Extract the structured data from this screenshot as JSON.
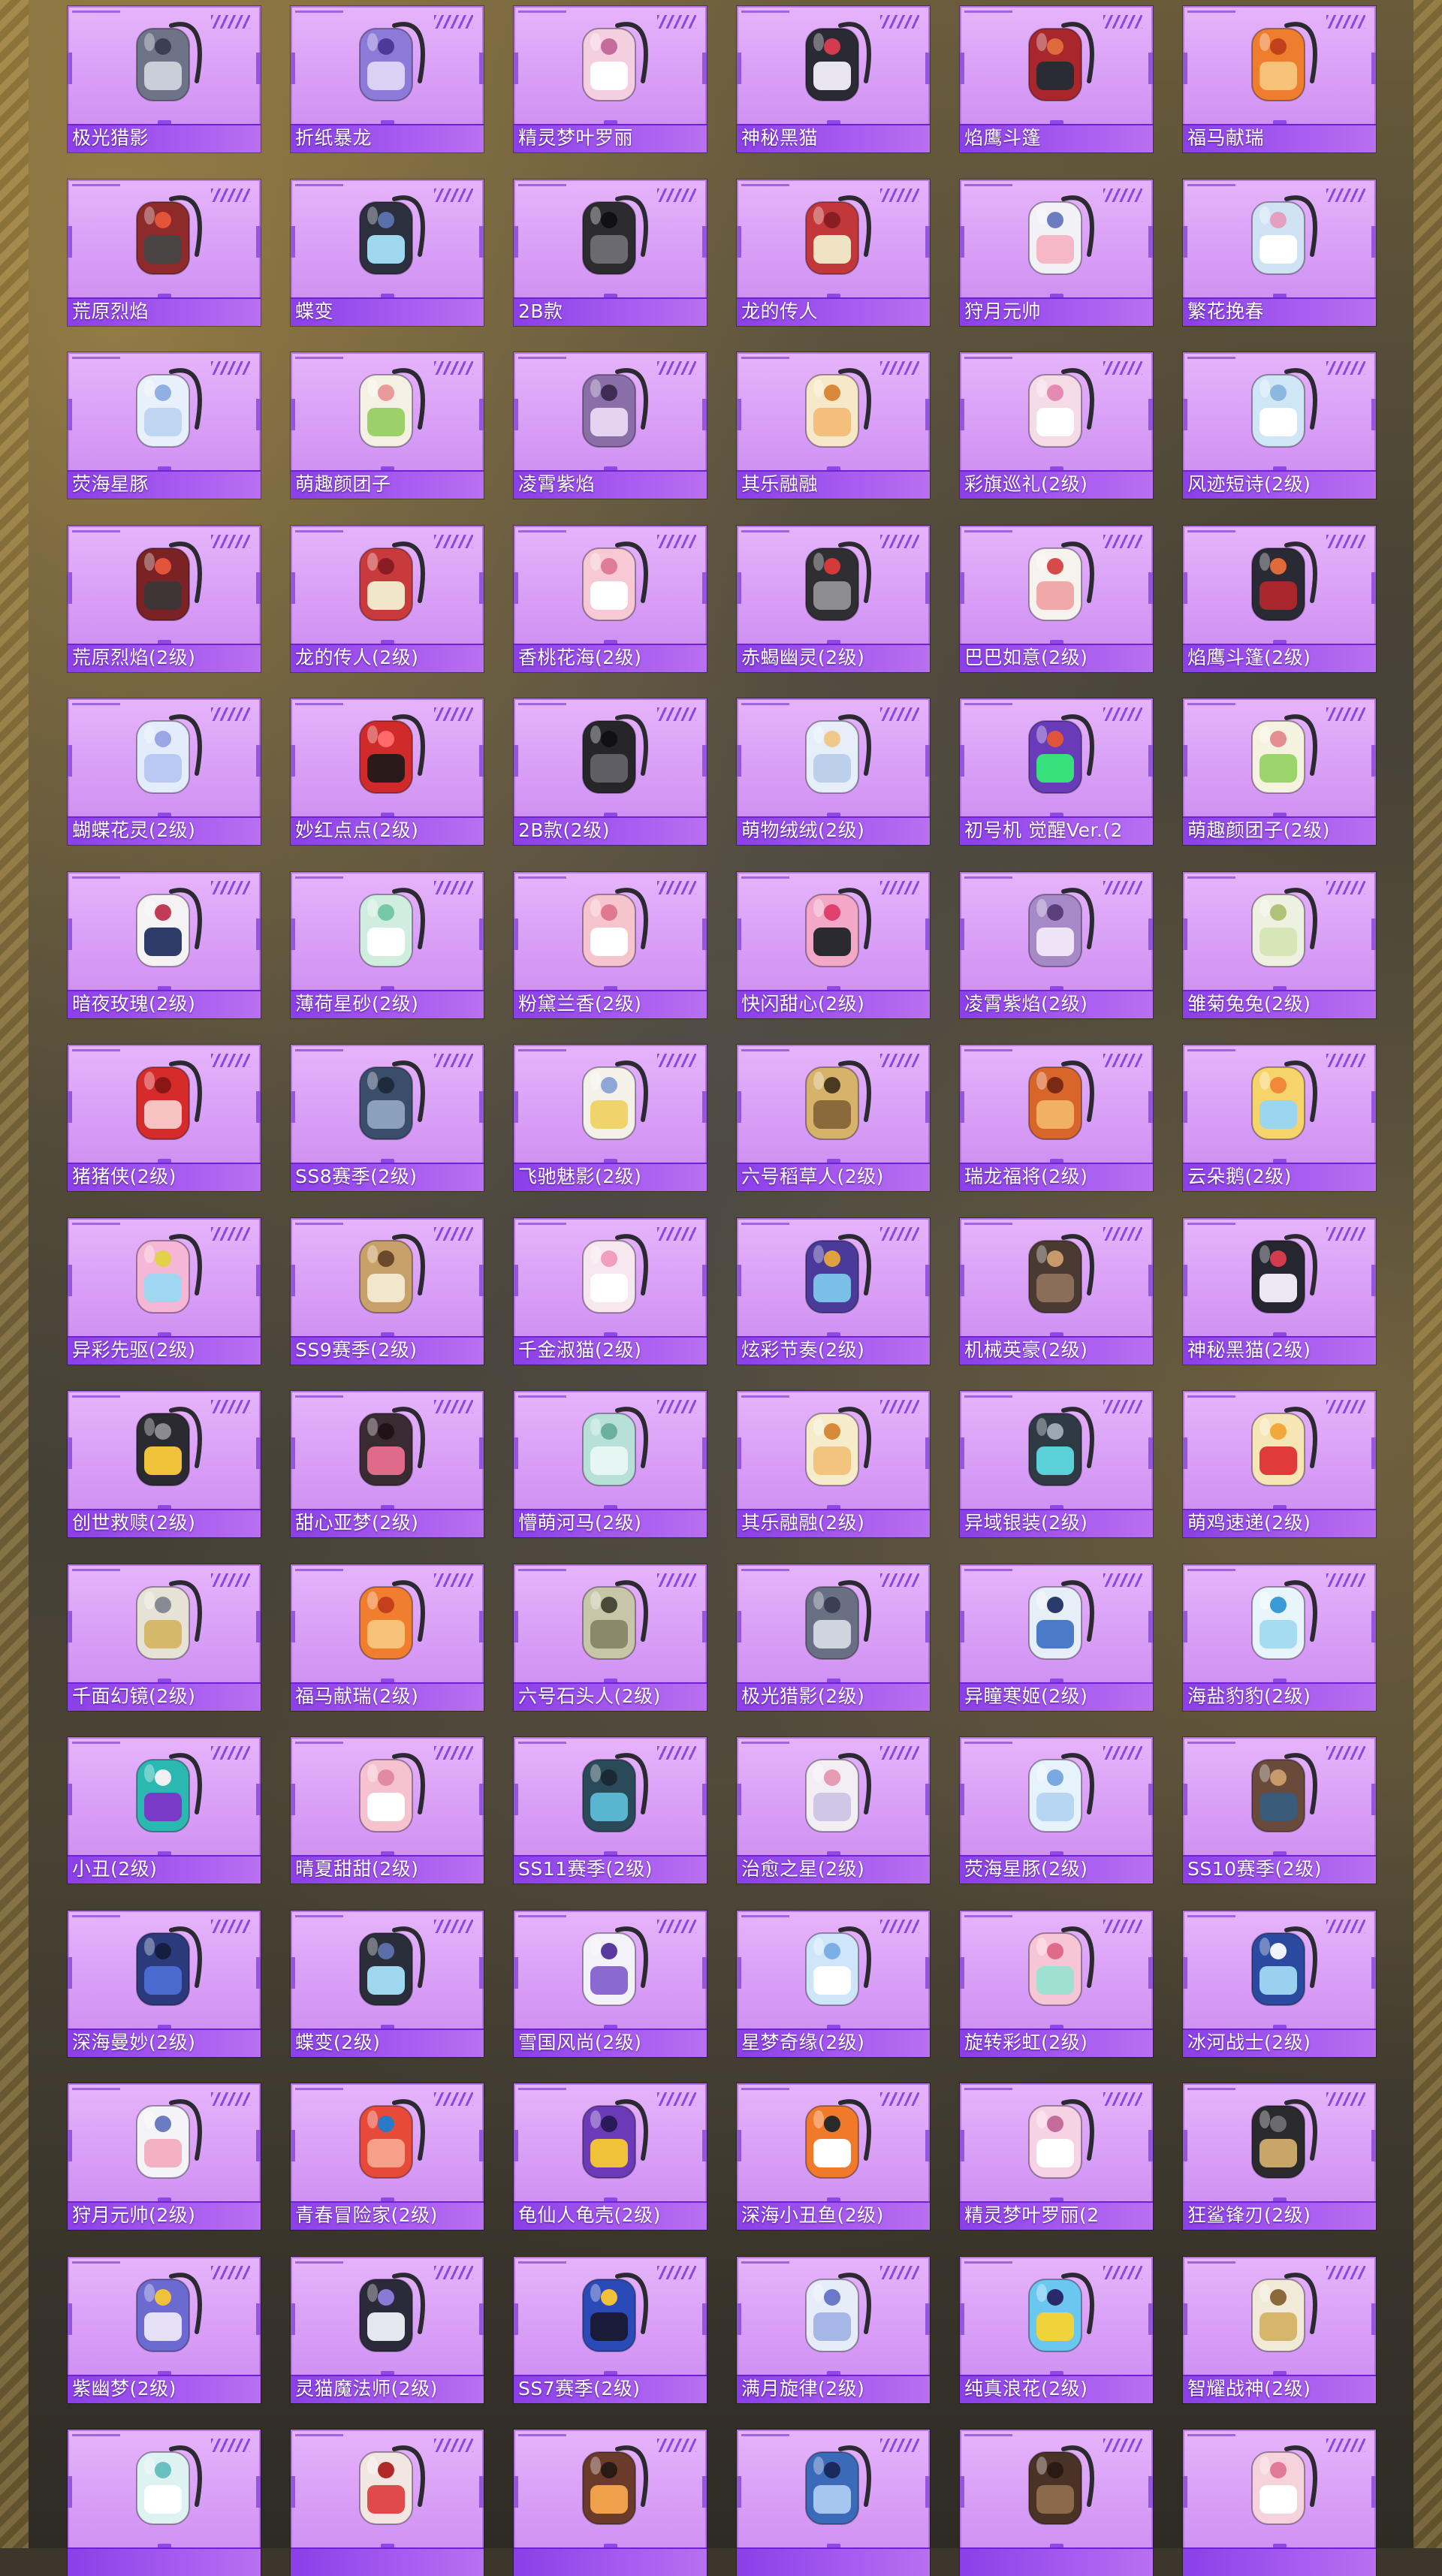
{
  "colors": {
    "card_bg": "#dca3f7",
    "label_bar": "#9a4ded",
    "label_text": "#ffffff",
    "stripe_accent": "#8b48e0"
  },
  "backpacks": [
    {
      "name": "极光猎影",
      "icon": "robot-claw-backpack-icon",
      "primary": "#6e7488",
      "secondary": "#c9ced8",
      "accent": "#3b3f55"
    },
    {
      "name": "折纸暴龙",
      "icon": "origami-dino-backpack-icon",
      "primary": "#8b7ad8",
      "secondary": "#d9d2f5",
      "accent": "#4b3a99"
    },
    {
      "name": "精灵梦叶罗丽",
      "icon": "heart-locket-backpack-icon",
      "primary": "#f3cfe0",
      "secondary": "#ffffff",
      "accent": "#c46c9c"
    },
    {
      "name": "神秘黑猫",
      "icon": "black-cat-backpack-icon",
      "primary": "#2a2a35",
      "secondary": "#e9e5ef",
      "accent": "#d33b4f"
    },
    {
      "name": "焰鹰斗篷",
      "icon": "red-armor-backpack-icon",
      "primary": "#a8262c",
      "secondary": "#2b2b33",
      "accent": "#e06b3a"
    },
    {
      "name": "福马献瑞",
      "icon": "orange-horse-backpack-icon",
      "primary": "#ef7d2e",
      "secondary": "#f6c27a",
      "accent": "#c2411c"
    },
    {
      "name": "荒原烈焰",
      "icon": "red-tactical-backpack-icon",
      "primary": "#8e2a2a",
      "secondary": "#4a4444",
      "accent": "#e3543b"
    },
    {
      "name": "蝶变",
      "icon": "butterfly-backpack-icon",
      "primary": "#2b2f3e",
      "secondary": "#9fd7ef",
      "accent": "#5a6fa8"
    },
    {
      "name": "2B款",
      "icon": "black-leather-backpack-icon",
      "primary": "#2c2c2f",
      "secondary": "#6a6a70",
      "accent": "#111114"
    },
    {
      "name": "龙的传人",
      "icon": "dragon-red-backpack-icon",
      "primary": "#c2383a",
      "secondary": "#f0e3c4",
      "accent": "#8a1d23"
    },
    {
      "name": "狩月元帅",
      "icon": "moon-marshal-backpack-icon",
      "primary": "#f2f2f6",
      "secondary": "#f6b7c6",
      "accent": "#6b7dc0"
    },
    {
      "name": "繁花挽春",
      "icon": "flower-bag-backpack-icon",
      "primary": "#cfe3f5",
      "secondary": "#ffffff",
      "accent": "#e59fbf"
    },
    {
      "name": "荧海星豚",
      "icon": "star-dolphin-backpack-icon",
      "primary": "#e8f0fb",
      "secondary": "#bfd6f2",
      "accent": "#8fb0e0"
    },
    {
      "name": "萌趣颜团子",
      "icon": "green-bunny-plush-icon",
      "primary": "#f4f1e4",
      "secondary": "#9cd16a",
      "accent": "#e99a9a"
    },
    {
      "name": "凌霄紫焰",
      "icon": "purple-flame-ornament-icon",
      "primary": "#8a6ea8",
      "secondary": "#e4d4f2",
      "accent": "#3d2d52"
    },
    {
      "name": "其乐融融",
      "icon": "cupcake-bunny-backpack-icon",
      "primary": "#f6e8c8",
      "secondary": "#f2c07a",
      "accent": "#d88a3a"
    },
    {
      "name": "彩旗巡礼(2级)",
      "icon": "bunny-ribbon-backpack-icon",
      "primary": "#f4dbe6",
      "secondary": "#ffffff",
      "accent": "#e48bb4"
    },
    {
      "name": "风迹短诗(2级)",
      "icon": "blue-box-backpack-icon",
      "primary": "#cfe6f6",
      "secondary": "#ffffff",
      "accent": "#8bb7e0"
    },
    {
      "name": "荒原烈焰(2级)",
      "icon": "red-tactical-backpack-icon",
      "primary": "#7a2224",
      "secondary": "#3d3536",
      "accent": "#e3543b"
    },
    {
      "name": "龙的传人(2级)",
      "icon": "dragon-red-backpack-icon",
      "primary": "#c83a3c",
      "secondary": "#f2e6c8",
      "accent": "#8a1d23"
    },
    {
      "name": "香桃花海(2级)",
      "icon": "peach-blossom-backpack-icon",
      "primary": "#f6c9d4",
      "secondary": "#ffffff",
      "accent": "#e07c98"
    },
    {
      "name": "赤蝎幽灵(2级)",
      "icon": "scorpion-ghost-backpack-icon",
      "primary": "#2e2e33",
      "secondary": "#8d8d92",
      "accent": "#d33b3b"
    },
    {
      "name": "巴巴如意(2级)",
      "icon": "white-bunny-backpack-icon",
      "primary": "#f6f3ee",
      "secondary": "#f0a8a8",
      "accent": "#d64a4a"
    },
    {
      "name": "焰鹰斗篷(2级)",
      "icon": "red-armor-backpack-icon",
      "primary": "#2a2a34",
      "secondary": "#a8262c",
      "accent": "#e06b3a"
    },
    {
      "name": "蝴蝶花灵(2级)",
      "icon": "butterfly-fairy-backpack-icon",
      "primary": "#e2ecfb",
      "secondary": "#b9c9f3",
      "accent": "#9aa6e6"
    },
    {
      "name": "妙红点点(2级)",
      "icon": "ladybug-backpack-icon",
      "primary": "#d12a2a",
      "secondary": "#2a1a1a",
      "accent": "#ff6b6b"
    },
    {
      "name": "2B款(2级)",
      "icon": "black-leather-backpack-icon",
      "primary": "#262629",
      "secondary": "#5e5e64",
      "accent": "#111114"
    },
    {
      "name": "萌物绒绒(2级)",
      "icon": "fluffy-bunny-backpack-icon",
      "primary": "#e5eef9",
      "secondary": "#bcd0ec",
      "accent": "#f0c98a"
    },
    {
      "name": "初号机 觉醒Ver.(2",
      "icon": "eva-unit-backpack-icon",
      "primary": "#6a3bb8",
      "secondary": "#36e07a",
      "accent": "#e0553a"
    },
    {
      "name": "萌趣颜团子(2级)",
      "icon": "green-bunny-plush-icon",
      "primary": "#f6f2e0",
      "secondary": "#9bd46a",
      "accent": "#e48f8f"
    },
    {
      "name": "暗夜玫瑰(2级)",
      "icon": "rose-bunny-backpack-icon",
      "primary": "#f4f2f2",
      "secondary": "#2f3c6a",
      "accent": "#c23c5a"
    },
    {
      "name": "薄荷星砂(2级)",
      "icon": "mint-star-backpack-icon",
      "primary": "#cfeee0",
      "secondary": "#ffffff",
      "accent": "#76c7a6"
    },
    {
      "name": "粉黛兰香(2级)",
      "icon": "pink-orchid-pouch-icon",
      "primary": "#f6c4cc",
      "secondary": "#ffffff",
      "accent": "#e07890"
    },
    {
      "name": "快闪甜心(2级)",
      "icon": "pink-round-bag-icon",
      "primary": "#f2a8c6",
      "secondary": "#2a2a30",
      "accent": "#e0406e"
    },
    {
      "name": "凌霄紫焰(2级)",
      "icon": "purple-flame-ornament-icon",
      "primary": "#a68ac8",
      "secondary": "#efe3f8",
      "accent": "#5a3f7a"
    },
    {
      "name": "雏菊兔兔(2级)",
      "icon": "daisy-bunny-backpack-icon",
      "primary": "#eef0e0",
      "secondary": "#d6e6b6",
      "accent": "#b0c27a"
    },
    {
      "name": "猪猪侠(2级)",
      "icon": "red-pig-backpack-icon",
      "primary": "#d62b2b",
      "secondary": "#f7c2c2",
      "accent": "#8a1616"
    },
    {
      "name": "SS8赛季(2级)",
      "icon": "blue-hiking-backpack-icon",
      "primary": "#3a4d6a",
      "secondary": "#8aa0bc",
      "accent": "#1f2a3d"
    },
    {
      "name": "飞驰魅影(2级)",
      "icon": "white-racer-backpack-icon",
      "primary": "#f4f1e8",
      "secondary": "#f0d36a",
      "accent": "#8fa7d6"
    },
    {
      "name": "六号稻草人(2级)",
      "icon": "scarecrow-backpack-icon",
      "primary": "#d6b26a",
      "secondary": "#8a6a3a",
      "accent": "#4a3a22"
    },
    {
      "name": "瑞龙福将(2级)",
      "icon": "orange-armor-backpack-icon",
      "primary": "#d8662a",
      "secondary": "#f2b064",
      "accent": "#7a2a14"
    },
    {
      "name": "云朵鹅(2级)",
      "icon": "yellow-duck-backpack-icon",
      "primary": "#f6d46a",
      "secondary": "#9bd6ee",
      "accent": "#f08a3a"
    },
    {
      "name": "异彩先驱(2级)",
      "icon": "colorful-pioneer-backpack-icon",
      "primary": "#f6b6d6",
      "secondary": "#9fd6f0",
      "accent": "#e2d24a"
    },
    {
      "name": "SS9赛季(2级)",
      "icon": "tan-canvas-backpack-icon",
      "primary": "#c8a06a",
      "secondary": "#f2e6cc",
      "accent": "#6a4a2a"
    },
    {
      "name": "千金淑猫(2级)",
      "icon": "lady-cat-backpack-icon",
      "primary": "#f6e8ee",
      "secondary": "#ffffff",
      "accent": "#f0a0be"
    },
    {
      "name": "炫彩节奏(2级)",
      "icon": "galaxy-rhythm-backpack-icon",
      "primary": "#4a3a9a",
      "secondary": "#7ac0e6",
      "accent": "#e0a040"
    },
    {
      "name": "机械英豪(2级)",
      "icon": "mech-hero-backpack-icon",
      "primary": "#4a3a32",
      "secondary": "#8a6e5a",
      "accent": "#c89a6a"
    },
    {
      "name": "神秘黑猫(2级)",
      "icon": "black-cat-backpack-icon",
      "primary": "#262630",
      "secondary": "#ece8f2",
      "accent": "#d33b4f"
    },
    {
      "name": "创世救赎(2级)",
      "icon": "genesis-armor-backpack-icon",
      "primary": "#2a2a30",
      "secondary": "#f0c23a",
      "accent": "#8a8a92"
    },
    {
      "name": "甜心亚梦(2级)",
      "icon": "dark-sweetheart-backpack-icon",
      "primary": "#3a2a32",
      "secondary": "#e06a8a",
      "accent": "#1e1418"
    },
    {
      "name": "懵萌河马(2级)",
      "icon": "hippo-plush-backpack-icon",
      "primary": "#b6e0d8",
      "secondary": "#e6f6f2",
      "accent": "#6ab0a0"
    },
    {
      "name": "其乐融融(2级)",
      "icon": "cupcake-bunny-backpack-icon",
      "primary": "#f6eccc",
      "secondary": "#f2c47e",
      "accent": "#d88a3a"
    },
    {
      "name": "异域银装(2级)",
      "icon": "silver-tech-backpack-icon",
      "primary": "#2f3a44",
      "secondary": "#5ad0d8",
      "accent": "#9aa8b4"
    },
    {
      "name": "萌鸡速递(2级)",
      "icon": "chick-courier-backpack-icon",
      "primary": "#f6e6b6",
      "secondary": "#e03a3a",
      "accent": "#f2a83a"
    },
    {
      "name": "千面幻镜(2级)",
      "icon": "mirror-gold-backpack-icon",
      "primary": "#e6e2d6",
      "secondary": "#d6b86a",
      "accent": "#8a8a96"
    },
    {
      "name": "福马献瑞(2级)",
      "icon": "orange-horse-backpack-icon",
      "primary": "#f07e2e",
      "secondary": "#f6c27a",
      "accent": "#c2411c"
    },
    {
      "name": "六号石头人(2级)",
      "icon": "stone-golem-backpack-icon",
      "primary": "#c8c6a8",
      "secondary": "#8a8a6a",
      "accent": "#4a4a3a"
    },
    {
      "name": "极光猎影(2级)",
      "icon": "robot-claw-backpack-icon",
      "primary": "#6a7084",
      "secondary": "#d0d4de",
      "accent": "#3b3f55"
    },
    {
      "name": "异瞳寒姬(2级)",
      "icon": "ice-princess-backpack-icon",
      "primary": "#e6eef8",
      "secondary": "#4a7ac8",
      "accent": "#2a3a6a"
    },
    {
      "name": "海盐豹豹(2级)",
      "icon": "sea-salt-leopard-backpack-icon",
      "primary": "#e8f6fc",
      "secondary": "#a6dcf2",
      "accent": "#3a9ad6"
    },
    {
      "name": "小丑(2级)",
      "icon": "clown-backpack-icon",
      "primary": "#2ab8b0",
      "secondary": "#7a3ac8",
      "accent": "#f0f0f0"
    },
    {
      "name": "晴夏甜甜(2级)",
      "icon": "pink-shell-backpack-icon",
      "primary": "#f6c2d0",
      "secondary": "#ffffff",
      "accent": "#e08aa6"
    },
    {
      "name": "SS11赛季(2级)",
      "icon": "teal-sport-backpack-icon",
      "primary": "#2a4a5a",
      "secondary": "#5ab6d0",
      "accent": "#1a2a34"
    },
    {
      "name": "治愈之星(2级)",
      "icon": "healing-star-backpack-icon",
      "primary": "#f2eef4",
      "secondary": "#d0c6e6",
      "accent": "#e69ab4"
    },
    {
      "name": "荧海星豚(2级)",
      "icon": "star-dolphin-backpack-icon",
      "primary": "#e6f2fc",
      "secondary": "#b6d6f2",
      "accent": "#7aa8e0"
    },
    {
      "name": "SS10赛季(2级)",
      "icon": "brown-canvas-backpack-icon",
      "primary": "#6a4a3a",
      "secondary": "#3a5a7a",
      "accent": "#c89a6a"
    },
    {
      "name": "深海曼妙(2级)",
      "icon": "deep-sea-backpack-icon",
      "primary": "#2a3a7a",
      "secondary": "#4a6ad0",
      "accent": "#161e40"
    },
    {
      "name": "蝶变(2级)",
      "icon": "butterfly-backpack-icon",
      "primary": "#2a2e3a",
      "secondary": "#9fd7ef",
      "accent": "#5a6fa8"
    },
    {
      "name": "雪国风尚(2级)",
      "icon": "snow-fashion-backpack-icon",
      "primary": "#f2f2f8",
      "secondary": "#8a6ad0",
      "accent": "#5a3aa0"
    },
    {
      "name": "星梦奇缘(2级)",
      "icon": "star-swan-backpack-icon",
      "primary": "#cfe6fa",
      "secondary": "#ffffff",
      "accent": "#7ab0e6"
    },
    {
      "name": "旋转彩虹(2级)",
      "icon": "rainbow-carousel-backpack-icon",
      "primary": "#f6c6d6",
      "secondary": "#9fe0d0",
      "accent": "#e06a8a"
    },
    {
      "name": "冰河战士(2级)",
      "icon": "glacier-warrior-backpack-icon",
      "primary": "#2a4aa0",
      "secondary": "#9ad0f0",
      "accent": "#f0f4f8"
    },
    {
      "name": "狩月元帅(2级)",
      "icon": "moon-marshal-backpack-icon",
      "primary": "#f4f4f8",
      "secondary": "#f2b2c4",
      "accent": "#6b7dc0"
    },
    {
      "name": "青春冒险家(2级)",
      "icon": "red-fish-backpack-icon",
      "primary": "#e84a3a",
      "secondary": "#f6a08a",
      "accent": "#2a7ac8"
    },
    {
      "name": "龟仙人龟壳(2级)",
      "icon": "turtle-shell-backpack-icon",
      "primary": "#6a3ab8",
      "secondary": "#f0c23a",
      "accent": "#2a1a5a"
    },
    {
      "name": "深海小丑鱼(2级)",
      "icon": "clownfish-backpack-icon",
      "primary": "#f07a2a",
      "secondary": "#ffffff",
      "accent": "#2a2a2a"
    },
    {
      "name": "精灵梦叶罗丽(2",
      "icon": "heart-locket-backpack-icon",
      "primary": "#f6d2e4",
      "secondary": "#ffffff",
      "accent": "#c46c9c"
    },
    {
      "name": "狂鲨锋刃(2级)",
      "icon": "shark-blade-backpack-icon",
      "primary": "#2a2a2e",
      "secondary": "#c8a66a",
      "accent": "#6a6a70"
    },
    {
      "name": "紫幽梦(2级)",
      "icon": "purple-dream-backpack-icon",
      "primary": "#6a6ad0",
      "secondary": "#e6e0f6",
      "accent": "#f0c23a"
    },
    {
      "name": "灵猫魔法师(2级)",
      "icon": "magic-cat-backpack-icon",
      "primary": "#2a2a3a",
      "secondary": "#e6e6ee",
      "accent": "#8a7ad6"
    },
    {
      "name": "SS7赛季(2级)",
      "icon": "blue-camping-backpack-icon",
      "primary": "#2a4ab8",
      "secondary": "#1a1a3a",
      "accent": "#f0c23a"
    },
    {
      "name": "满月旋律(2级)",
      "icon": "moon-melody-backpack-icon",
      "primary": "#e6ecf8",
      "secondary": "#a6b6e6",
      "accent": "#6a7ac8"
    },
    {
      "name": "纯真浪花(2级)",
      "icon": "wave-bottle-backpack-icon",
      "primary": "#6ac8f0",
      "secondary": "#f0d23a",
      "accent": "#2a2a6a"
    },
    {
      "name": "智耀战神(2级)",
      "icon": "golden-warrior-backpack-icon",
      "primary": "#f2ead8",
      "secondary": "#d6b66a",
      "accent": "#8a6a3a"
    },
    {
      "name": "",
      "icon": "mint-cube-backpack-icon",
      "primary": "#dff2f2",
      "secondary": "#ffffff",
      "accent": "#6ac0c0"
    },
    {
      "name": "",
      "icon": "red-bunny-backpack-icon",
      "primary": "#f2e6e0",
      "secondary": "#e04a4a",
      "accent": "#b02a2a"
    },
    {
      "name": "",
      "icon": "orb-pendant-backpack-icon",
      "primary": "#6a3a2a",
      "secondary": "#f0a04a",
      "accent": "#2a1a14"
    },
    {
      "name": "",
      "icon": "blue-shield-backpack-icon",
      "primary": "#3a6ab8",
      "secondary": "#a6c6f0",
      "accent": "#1a2a5a"
    },
    {
      "name": "",
      "icon": "barrel-backpack-icon",
      "primary": "#4a3226",
      "secondary": "#8a6a4a",
      "accent": "#2a1a14"
    },
    {
      "name": "",
      "icon": "pink-ribbon-backpack-icon",
      "primary": "#f6d2dc",
      "secondary": "#ffffff",
      "accent": "#e07a98"
    }
  ]
}
